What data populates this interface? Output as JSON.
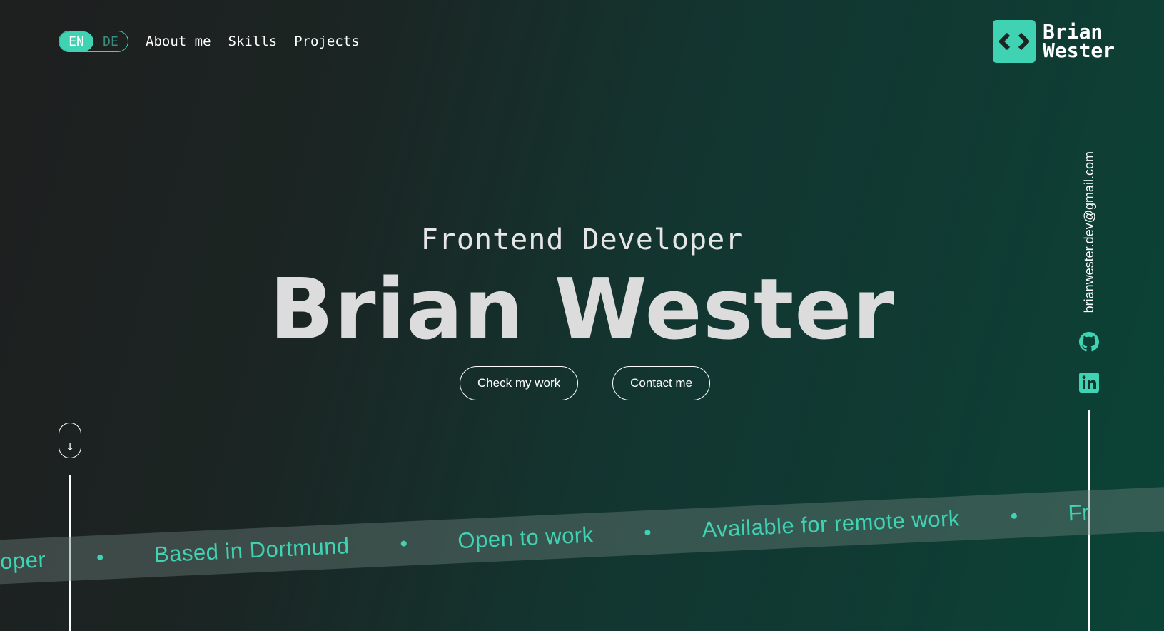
{
  "header": {
    "lang": {
      "active": "EN",
      "inactive": "DE"
    },
    "nav": [
      {
        "label": "About me"
      },
      {
        "label": "Skills"
      },
      {
        "label": "Projects"
      }
    ],
    "logo": {
      "icon": "code-brackets-icon",
      "line1": "Brian",
      "line2": "Wester"
    }
  },
  "hero": {
    "subtitle": "Frontend Developer",
    "title": "Brian Wester",
    "buttons": {
      "primary": "Check my work",
      "secondary": "Contact me"
    }
  },
  "scroll": {
    "icon": "arrow-down-icon",
    "glyph": "↓"
  },
  "sidebar": {
    "email": "brianwester.dev@gmail.com",
    "github_icon": "github-icon",
    "linkedin_icon": "linkedin-icon"
  },
  "marquee": {
    "items": [
      "eveloper",
      "Based in Dortmund",
      "Open to work",
      "Available for remote work",
      "Fr"
    ]
  },
  "colors": {
    "accent": "#3fd3b4",
    "text": "#ffffff",
    "title": "#dcdcdc"
  }
}
